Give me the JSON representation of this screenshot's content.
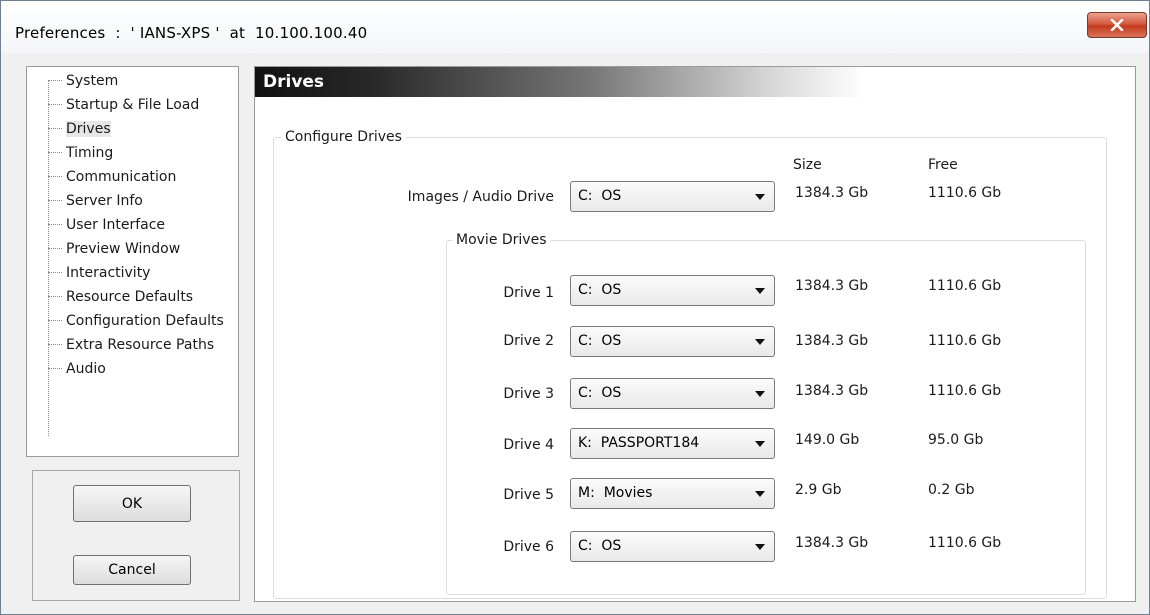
{
  "window": {
    "title": "Preferences  :  ' IANS-XPS '  at  10.100.100.40",
    "close_icon": "close-icon",
    "close_color": "#c3391d"
  },
  "sidebar": {
    "items": [
      {
        "label": "System"
      },
      {
        "label": "Startup & File Load"
      },
      {
        "label": "Drives",
        "selected": true
      },
      {
        "label": "Timing"
      },
      {
        "label": "Communication"
      },
      {
        "label": "Server Info"
      },
      {
        "label": "User Interface"
      },
      {
        "label": "Preview Window"
      },
      {
        "label": "Interactivity"
      },
      {
        "label": "Resource Defaults"
      },
      {
        "label": "Configuration Defaults"
      },
      {
        "label": "Extra Resource Paths"
      },
      {
        "label": "Audio"
      }
    ]
  },
  "buttons": {
    "ok_label": "OK",
    "cancel_label": "Cancel"
  },
  "main": {
    "header": "Drives",
    "configure_group_label": "Configure Drives",
    "size_header": "Size",
    "free_header": "Free",
    "images_audio": {
      "label": "Images / Audio Drive",
      "value": "C:  OS",
      "size": "1384.3 Gb",
      "free": "1110.6 Gb"
    },
    "movie_group_label": "Movie Drives",
    "drives": [
      {
        "label": "Drive 1",
        "value": "C:  OS",
        "size": "1384.3 Gb",
        "free": "1110.6 Gb"
      },
      {
        "label": "Drive 2",
        "value": "C:  OS",
        "size": "1384.3 Gb",
        "free": "1110.6 Gb"
      },
      {
        "label": "Drive 3",
        "value": "C:  OS",
        "size": "1384.3 Gb",
        "free": "1110.6 Gb"
      },
      {
        "label": "Drive 4",
        "value": "K:  PASSPORT184",
        "size": "149.0 Gb",
        "free": "95.0 Gb"
      },
      {
        "label": "Drive 5",
        "value": "M:  Movies",
        "size": "2.9 Gb",
        "free": "0.2 Gb"
      },
      {
        "label": "Drive 6",
        "value": "C:  OS",
        "size": "1384.3 Gb",
        "free": "1110.6 Gb"
      }
    ]
  }
}
